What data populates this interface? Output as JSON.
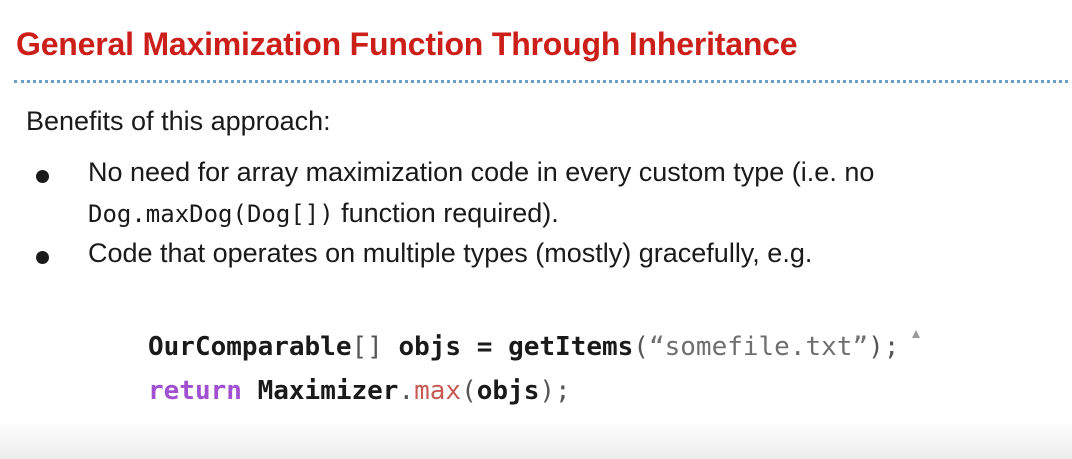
{
  "slide": {
    "title": "General Maximization Function Through Inheritance",
    "intro": "Benefits of this approach:",
    "bullets": [
      {
        "line1": "No need for array maximization code in every custom type (i.e. no",
        "line2_code": "Dog.maxDog(Dog[])",
        "line2_text": " function required)."
      },
      {
        "line1": "Code that operates on multiple types (mostly) gracefully, e.g."
      }
    ],
    "code": {
      "line1": {
        "type": "OurComparable",
        "brackets": "[]",
        "var": "objs",
        "eq": "=",
        "fn": "getItems",
        "open": "(",
        "str": "“somefile.txt”",
        "close": ");"
      },
      "line2": {
        "kw": "return",
        "cls": "Maximizer",
        "dot": ".",
        "method": "max",
        "open": "(",
        "arg": "objs",
        "close": ");"
      }
    },
    "colors": {
      "title": "#cc1f1a",
      "rule": "#6aa0c8",
      "keyword": "#a050d0",
      "method": "#c85a55",
      "string": "#6f6f6f"
    }
  }
}
